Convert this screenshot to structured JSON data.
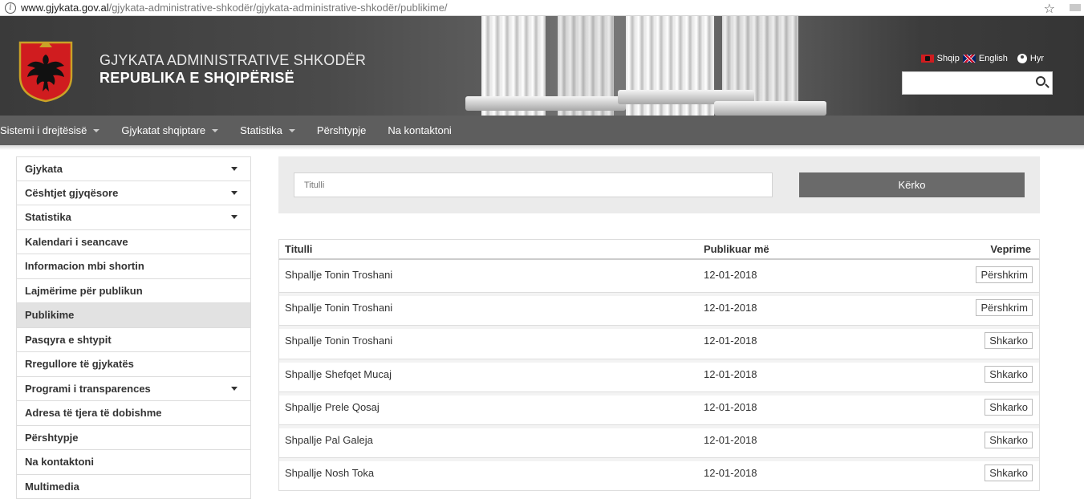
{
  "browser": {
    "url_host": "www.gjykata.gov.al",
    "url_path": "/gjykata-administrative-shkodër/gjykata-administrative-shkodër/publikime/"
  },
  "header": {
    "title_line1": "GJYKATA ADMINISTRATIVE SHKODËR",
    "title_line2": "REPUBLIKA E SHQIPËRISË",
    "lang_sq": "Shqip",
    "lang_en": "English",
    "login": "Hyr"
  },
  "nav": {
    "items": [
      {
        "label": "Sistemi i drejtësisë",
        "dropdown": true
      },
      {
        "label": "Gjykatat shqiptare",
        "dropdown": true
      },
      {
        "label": "Statistika",
        "dropdown": true
      },
      {
        "label": "Përshtypje",
        "dropdown": false
      },
      {
        "label": "Na kontaktoni",
        "dropdown": false
      }
    ]
  },
  "sidebar": {
    "items": [
      {
        "label": "Gjykata",
        "dropdown": true
      },
      {
        "label": "Cështjet gjyqësore",
        "dropdown": true
      },
      {
        "label": "Statistika",
        "dropdown": true
      },
      {
        "label": "Kalendari i seancave"
      },
      {
        "label": "Informacion mbi shortin"
      },
      {
        "label": "Lajmërime për publikun"
      },
      {
        "label": "Publikime",
        "active": true
      },
      {
        "label": "Pasqyra e shtypit"
      },
      {
        "label": "Rregullore të gjykatës"
      },
      {
        "label": "Programi i transparences",
        "dropdown": true
      },
      {
        "label": "Adresa të tjera të dobishme"
      },
      {
        "label": "Përshtypje"
      },
      {
        "label": "Na kontaktoni"
      },
      {
        "label": "Multimedia"
      }
    ]
  },
  "search": {
    "placeholder": "Titulli",
    "button": "Kërko"
  },
  "table": {
    "headers": {
      "title": "Titulli",
      "date": "Publikuar më",
      "actions": "Veprime"
    },
    "rows": [
      {
        "title": "Shpallje Tonin Troshani",
        "date": "12-01-2018",
        "action": "Përshkrim"
      },
      {
        "title": "Shpallje Tonin Troshani",
        "date": "12-01-2018",
        "action": "Përshkrim"
      },
      {
        "title": "Shpallje Tonin Troshani",
        "date": "12-01-2018",
        "action": "Shkarko"
      },
      {
        "title": "Shpallje Shefqet Mucaj",
        "date": "12-01-2018",
        "action": "Shkarko"
      },
      {
        "title": "Shpallje Prele Qosaj",
        "date": "12-01-2018",
        "action": "Shkarko"
      },
      {
        "title": "Shpallje Pal Galeja",
        "date": "12-01-2018",
        "action": "Shkarko"
      },
      {
        "title": "Shpallje Nosh Toka",
        "date": "12-01-2018",
        "action": "Shkarko"
      }
    ]
  },
  "colors": {
    "nav_bg": "#5e5e5e",
    "button_bg": "#6a6a6a",
    "active_item_bg": "#e2e2e2",
    "emblem_red": "#d01c1f"
  }
}
